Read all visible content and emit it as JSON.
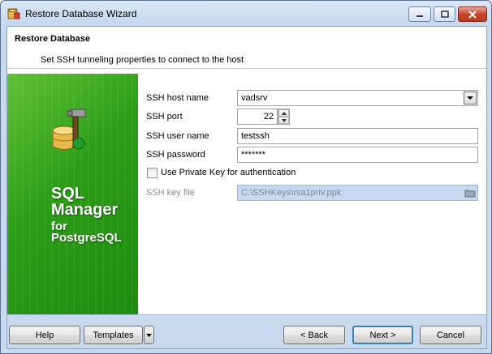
{
  "window": {
    "title": "Restore Database Wizard"
  },
  "header": {
    "title": "Restore Database",
    "subtitle": "Set SSH tunneling properties to connect to the host"
  },
  "sidebar": {
    "line1": "SQL",
    "line2": "Manager",
    "line3": "for",
    "line4": "PostgreSQL"
  },
  "form": {
    "host_label": "SSH host name",
    "host_value": "vadsrv",
    "port_label": "SSH port",
    "port_value": "22",
    "user_label": "SSH user name",
    "user_value": "testssh",
    "password_label": "SSH password",
    "password_value": "*******",
    "private_key_label": "Use Private Key for authentication",
    "private_key_checked": false,
    "key_file_label": "SSH key file",
    "key_file_value": "C:\\SSHKeys\\rsa1priv.ppk"
  },
  "footer": {
    "help": "Help",
    "templates": "Templates",
    "back": "< Back",
    "next": "Next >",
    "cancel": "Cancel"
  },
  "icons": {
    "app": "wizard-app-icon",
    "logo": "database-hammer-icon",
    "dropdown": "chevron-down-icon",
    "browse": "folder-browse-icon"
  },
  "colors": {
    "sidebar_green": "#2c9d16",
    "frame_blue": "#c9d9ee",
    "disabled_field": "#c6d9f0",
    "close_red": "#c8442c"
  }
}
